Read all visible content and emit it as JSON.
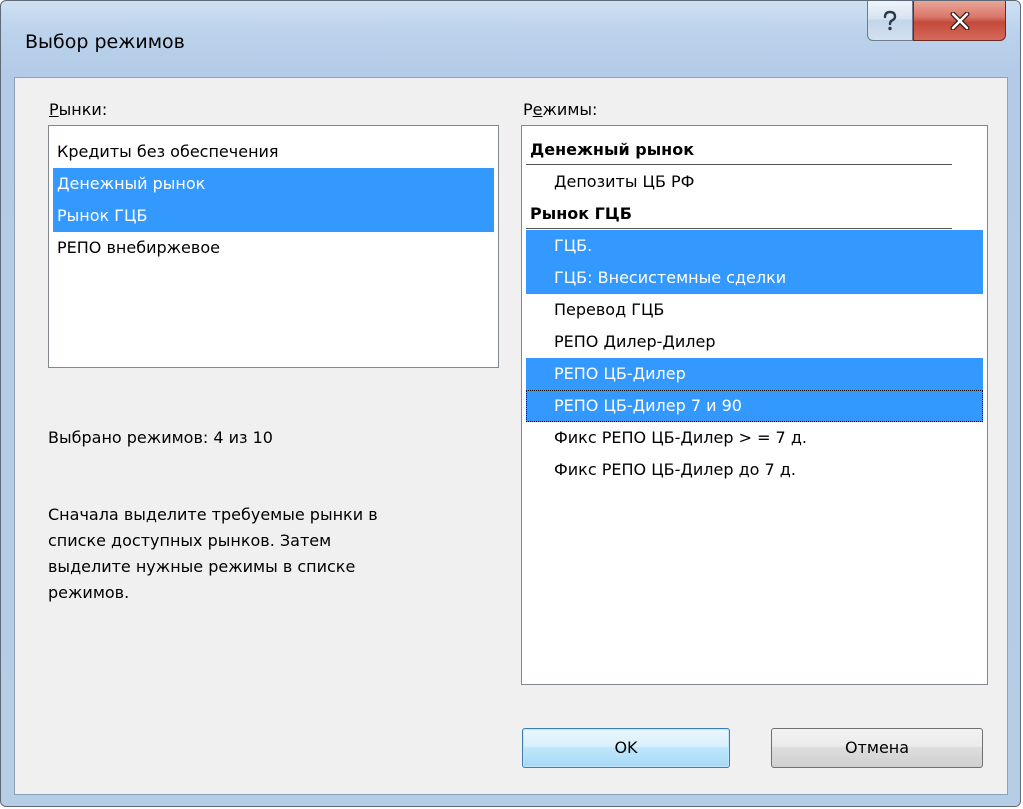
{
  "window": {
    "title": "Выбор режимов"
  },
  "markets": {
    "label_prefix": "Р",
    "label_rest": "ынки:",
    "items": [
      {
        "label": "Кредиты без обеспечения",
        "selected": false
      },
      {
        "label": "Денежный рынок",
        "selected": true
      },
      {
        "label": "Рынок ГЦБ",
        "selected": true
      },
      {
        "label": "РЕПО  внебиржевое",
        "selected": false
      }
    ]
  },
  "modes": {
    "label_pre": "Р",
    "label_underlined": "е",
    "label_rest": "жимы:",
    "groups": [
      {
        "title": "Денежный рынок",
        "items": [
          {
            "label": "Депозиты ЦБ РФ",
            "selected": false
          }
        ]
      },
      {
        "title": "Рынок ГЦБ",
        "items": [
          {
            "label": "ГЦБ.",
            "selected": true
          },
          {
            "label": "ГЦБ: Внесистемные сделки",
            "selected": true
          },
          {
            "label": "Перевод ГЦБ",
            "selected": false
          },
          {
            "label": "РЕПО Дилер-Дилер",
            "selected": false
          },
          {
            "label": "РЕПО ЦБ-Дилер",
            "selected": true
          },
          {
            "label": "РЕПО ЦБ-Дилер 7 и 90",
            "selected": true,
            "focused": true
          },
          {
            "label": "Фикс РЕПО ЦБ-Дилер > = 7 д.",
            "selected": false
          },
          {
            "label": "Фикс РЕПО ЦБ-Дилер до 7 д.",
            "selected": false
          }
        ]
      }
    ]
  },
  "status": {
    "selected_count": "Выбрано режимов: 4 из 10"
  },
  "hint": {
    "line1": "Сначала выделите требуемые рынки в",
    "line2": "списке доступных рынков. Затем",
    "line3": "выделите нужные режимы в списке",
    "line4": "режимов."
  },
  "buttons": {
    "ok": "OK",
    "cancel": "Отмена"
  },
  "colors": {
    "selection": "#3399ff",
    "close_button": "#c34a3b"
  }
}
